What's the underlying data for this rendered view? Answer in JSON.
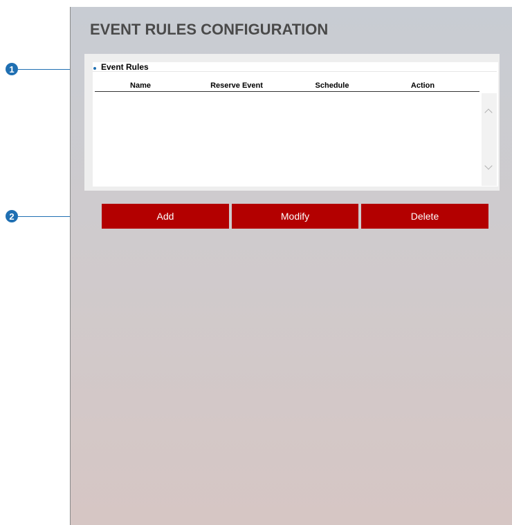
{
  "page": {
    "title": "EVENT RULES CONFIGURATION"
  },
  "event_rules": {
    "label": "Event Rules",
    "columns": [
      "Name",
      "Reserve Event",
      "Schedule",
      "Action"
    ]
  },
  "actions": {
    "add_label": "Add",
    "modify_label": "Modify",
    "delete_label": "Delete"
  },
  "callouts": {
    "first": "1",
    "second": "2"
  },
  "colors": {
    "button_bg": "#b30000",
    "callout_blue": "#1f6fb2"
  }
}
